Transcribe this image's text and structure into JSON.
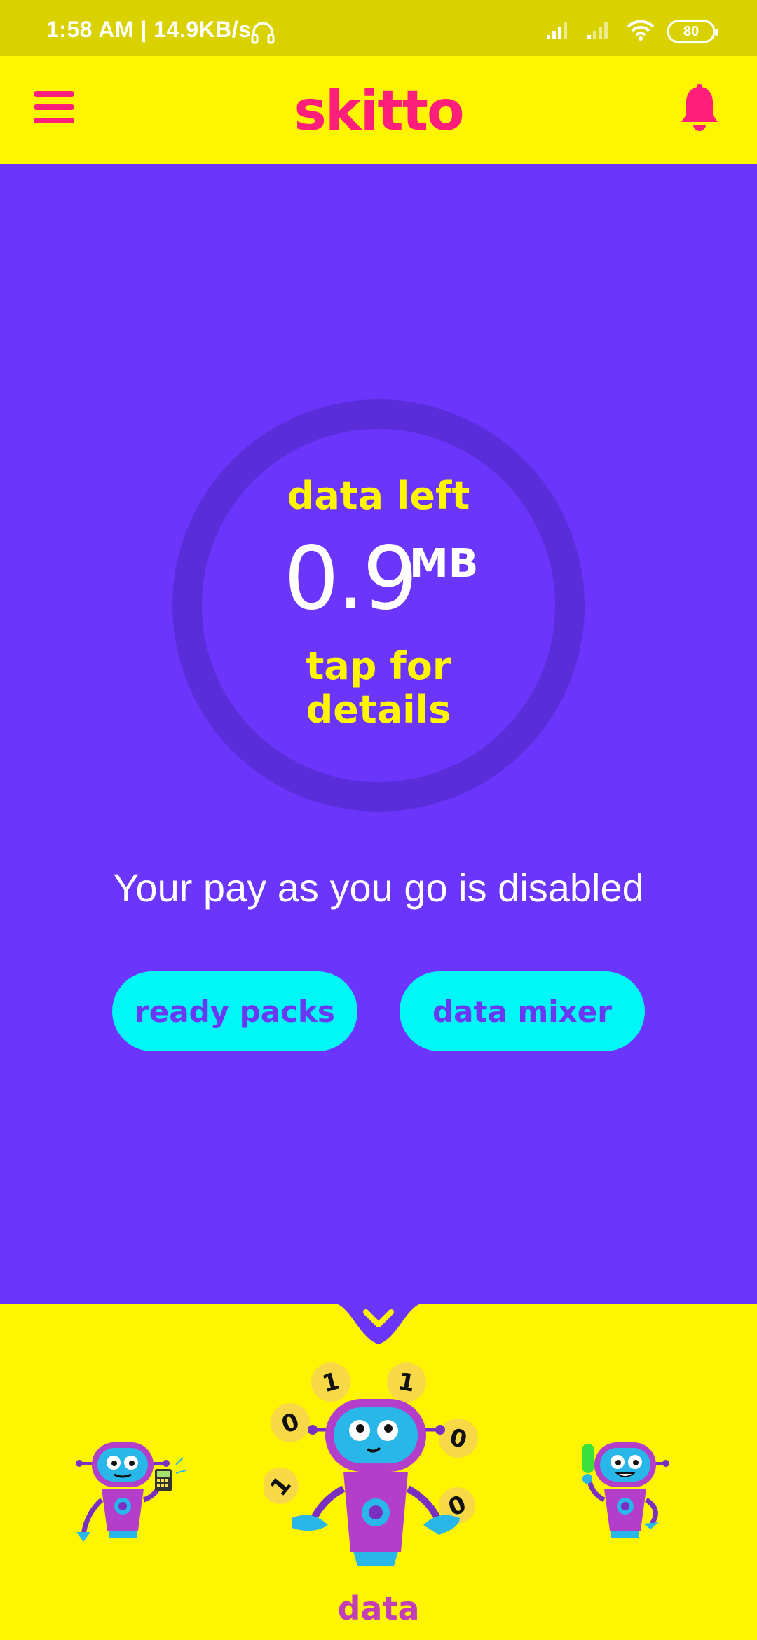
{
  "status_bar": {
    "time": "1:58 AM | 14.9KB/s",
    "battery": "80"
  },
  "header": {
    "logo_text": "skitto"
  },
  "data_widget": {
    "label": "data left",
    "value": "0.9",
    "unit": "MB",
    "tap_hint_line1": "tap for",
    "tap_hint_line2": "details"
  },
  "payg_status": "Your pay as you go is disabled",
  "buttons": {
    "ready_packs": "ready packs",
    "data_mixer": "data mixer"
  },
  "carousel": {
    "active_label": "data",
    "digits": [
      "1",
      "1",
      "0",
      "0",
      "1",
      "0"
    ]
  },
  "colors": {
    "brand_pink": "#ff1f7a",
    "brand_yellow": "#fff500",
    "main_purple": "#6c35fb",
    "accent_cyan": "#00f7f7"
  }
}
